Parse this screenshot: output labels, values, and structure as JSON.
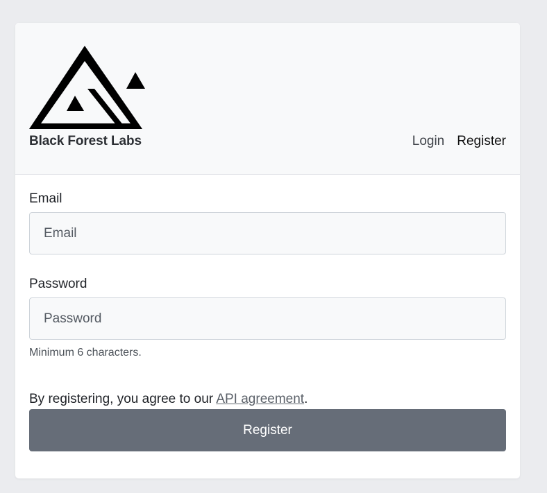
{
  "brand": {
    "name": "Black Forest Labs",
    "logo_icon": "triangle-mountain-logo"
  },
  "nav": {
    "login_label": "Login",
    "register_label": "Register"
  },
  "form": {
    "email": {
      "label": "Email",
      "placeholder": "Email",
      "value": ""
    },
    "password": {
      "label": "Password",
      "placeholder": "Password",
      "value": "",
      "help": "Minimum 6 characters."
    },
    "agreement": {
      "prefix": "By registering, you agree to our ",
      "link_text": "API agreement",
      "suffix": "."
    },
    "submit_label": "Register"
  },
  "colors": {
    "page_background": "#ebecef",
    "card_background": "#ffffff",
    "header_background": "#f8f9fa",
    "button_background": "#666d78",
    "button_text": "#ffffff"
  }
}
